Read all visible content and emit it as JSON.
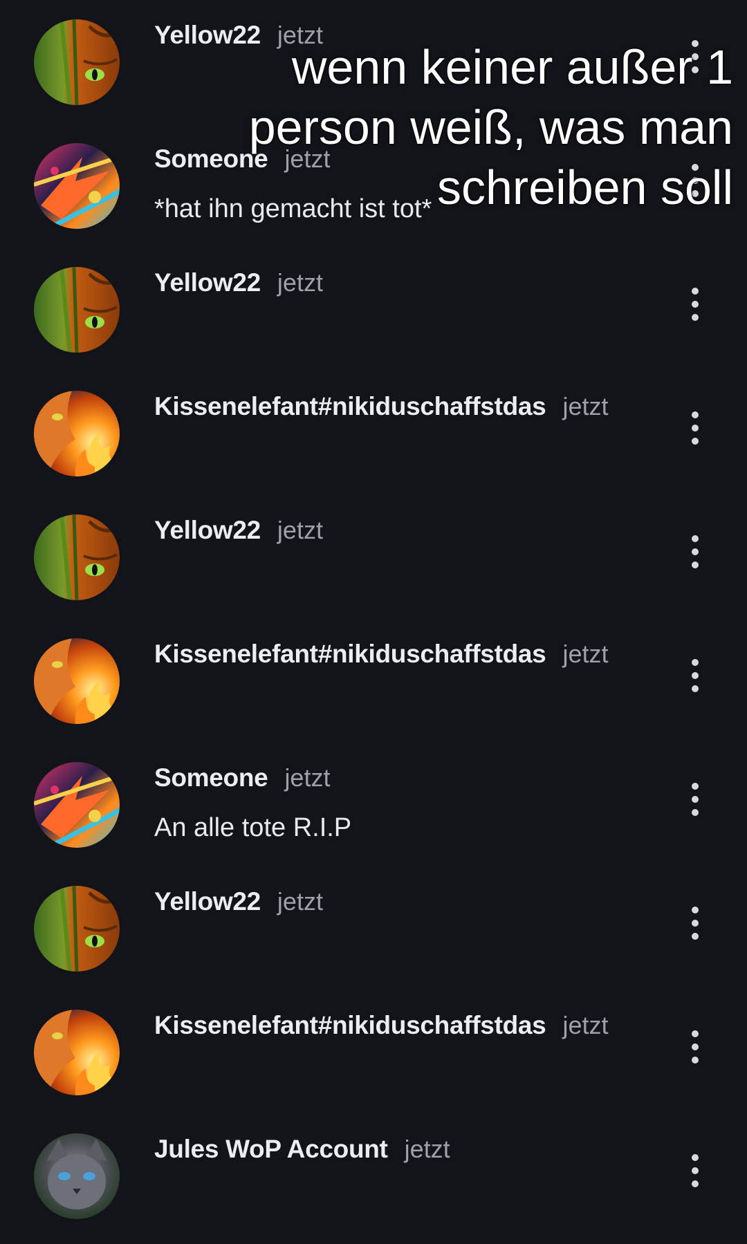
{
  "overlay_caption": "wenn keiner außer 1 person weiß, was man schreiben soll",
  "comments": [
    {
      "user": "Yellow22",
      "time": "jetzt",
      "message": "",
      "avatar": "tabby-cat-icon"
    },
    {
      "user": "Someone",
      "time": "jetzt",
      "message": "*hat ihn gemacht ist tot*",
      "avatar": "abstract-art-icon"
    },
    {
      "user": "Yellow22",
      "time": "jetzt",
      "message": "",
      "avatar": "tabby-cat-icon"
    },
    {
      "user": "Kissenelefant#nikiduschaffstdas",
      "time": "jetzt",
      "message": "",
      "avatar": "fire-cat-icon"
    },
    {
      "user": "Yellow22",
      "time": "jetzt",
      "message": "",
      "avatar": "tabby-cat-icon"
    },
    {
      "user": "Kissenelefant#nikiduschaffstdas",
      "time": "jetzt",
      "message": "",
      "avatar": "fire-cat-icon"
    },
    {
      "user": "Someone",
      "time": "jetzt",
      "message": "An alle tote R.I.P",
      "avatar": "abstract-art-icon"
    },
    {
      "user": "Yellow22",
      "time": "jetzt",
      "message": "",
      "avatar": "tabby-cat-icon"
    },
    {
      "user": "Kissenelefant#nikiduschaffstdas",
      "time": "jetzt",
      "message": "",
      "avatar": "fire-cat-icon"
    },
    {
      "user": "Jules WoP Account",
      "time": "jetzt",
      "message": "",
      "avatar": "gray-cat-icon"
    }
  ]
}
